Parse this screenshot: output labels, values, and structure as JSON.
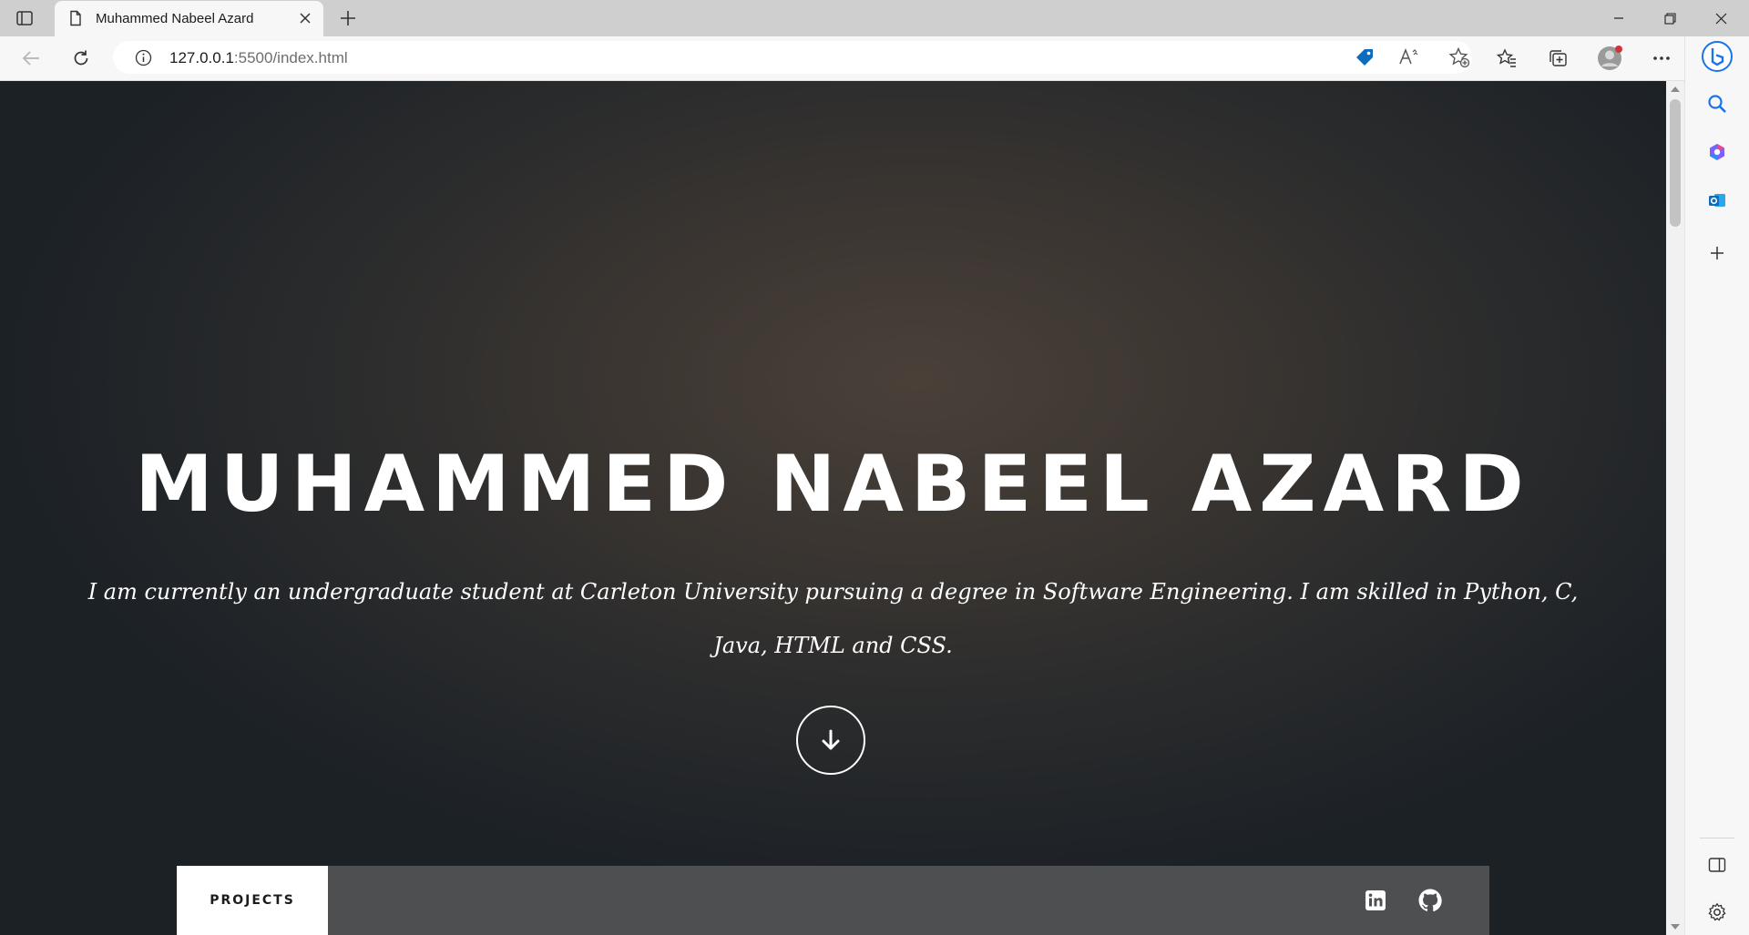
{
  "browser": {
    "tab": {
      "title": "Muhammed Nabeel Azard"
    },
    "address": {
      "host": "127.0.0.1",
      "rest": ":5500/index.html"
    }
  },
  "page": {
    "title": "MUHAMMED NABEEL AZARD",
    "description": "I am currently an undergraduate student at Carleton University pursuing a degree in Software Engineering. I am skilled in Python, C, Java, HTML and CSS.",
    "nav": {
      "projects_label": "PROJECTS"
    }
  },
  "icons": {
    "tab_actions": "tab-actions-icon",
    "favicon": "page-icon",
    "close": "close-icon",
    "new_tab": "plus-icon",
    "back": "back-arrow-icon",
    "refresh": "refresh-icon",
    "info": "info-icon",
    "scroll_down": "arrow-down-icon",
    "linkedin": "linkedin-icon",
    "github": "github-icon"
  },
  "colors": {
    "accent": "#0f6cbd",
    "nav_background": "#4e4f51",
    "hero_text": "#ffffff"
  }
}
